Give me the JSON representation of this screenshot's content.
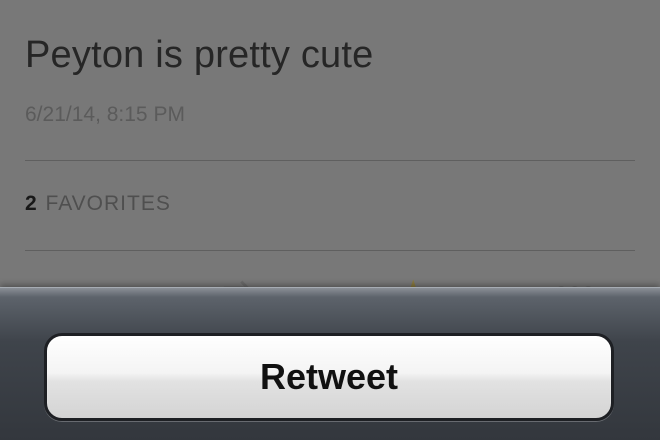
{
  "tweet": {
    "text": "Peyton is pretty cute",
    "timestamp": "6/21/14, 8:15 PM",
    "favorites_count": "2",
    "favorites_label": "FAVORITES"
  },
  "actions": {
    "reply_icon": "reply-icon",
    "retweet_icon": "retweet-icon",
    "favorite_icon": "star-icon",
    "more_icon": "more-icon"
  },
  "action_sheet": {
    "retweet_label": "Retweet"
  },
  "colors": {
    "dim_overlay": "#787878",
    "sheet_background": "#3f444b",
    "button_text": "#111111"
  }
}
